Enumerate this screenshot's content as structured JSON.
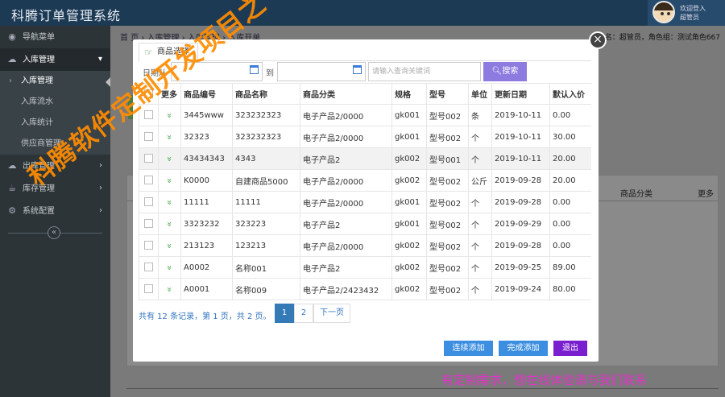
{
  "app": {
    "title": "科腾订单管理系统"
  },
  "user": {
    "greeting": "欢迎登入",
    "name": "超管员"
  },
  "sidebar": {
    "items": [
      {
        "label": "导航菜单",
        "icon": "dashboard-icon"
      },
      {
        "label": "入库管理",
        "icon": "cloud-upload-icon"
      },
      {
        "label": "出库管理",
        "icon": "cloud-download-icon"
      },
      {
        "label": "库存管理",
        "icon": "cup-icon"
      },
      {
        "label": "系统配置",
        "icon": "gear-icon"
      }
    ],
    "sub_items": [
      {
        "label": "入库管理"
      },
      {
        "label": "入库流水"
      },
      {
        "label": "入库统计"
      },
      {
        "label": "供应商管理"
      }
    ],
    "collapse_glyph": "«"
  },
  "breadcrumb": {
    "text": "首 页 › 入库管理 › 入库管理 › 入库开单"
  },
  "user_role": "名：超管员，角色组：测试角色667",
  "background_table": {
    "headers": [
      "商品分类",
      "更多"
    ]
  },
  "modal": {
    "tab_label": "商品选择",
    "date_from_label": "日期从",
    "date_to_label": "到",
    "search_placeholder": "请输入查询关键词",
    "search_button": "搜索",
    "close_glyph": "×",
    "table": {
      "headers": [
        "更多",
        "商品编号",
        "商品名称",
        "商品分类",
        "规格",
        "型号",
        "单位",
        "更新日期",
        "默认入价"
      ],
      "rows": [
        [
          "3445www",
          "323232323",
          "电子产品2/0000",
          "gk001",
          "型号002",
          "条",
          "2019-10-11",
          "0.00"
        ],
        [
          "32323",
          "323232323",
          "电子产品2/0000",
          "gk001",
          "型号002",
          "个",
          "2019-10-11",
          "30.00"
        ],
        [
          "43434343",
          "4343",
          "电子产品2",
          "gk002",
          "型号001",
          "个",
          "2019-10-11",
          "20.00"
        ],
        [
          "K0000",
          "自建商品5000",
          "电子产品2/0000",
          "gk002",
          "型号002",
          "公斤",
          "2019-09-28",
          "20.00"
        ],
        [
          "11111",
          "11111",
          "电子产品2/0000",
          "gk001",
          "型号002",
          "个",
          "2019-09-28",
          "0.00"
        ],
        [
          "3323232",
          "323223",
          "电子产品2",
          "gk001",
          "型号002",
          "个",
          "2019-09-29",
          "0.00"
        ],
        [
          "213123",
          "123213",
          "电子产品2/0000",
          "gk002",
          "型号002",
          "个",
          "2019-09-28",
          "0.00"
        ],
        [
          "A0002",
          "名称001",
          "电子产品2",
          "gk002",
          "型号002",
          "个",
          "2019-09-25",
          "89.00"
        ],
        [
          "A0001",
          "名称009",
          "电子产品2/2423432",
          "gk002",
          "型号002",
          "个",
          "2019-09-24",
          "80.00"
        ]
      ]
    },
    "pager": {
      "summary": "共有 12 条记录，第 1 页，共 2 页。",
      "page1": "1",
      "page2": "2",
      "next": "下一页"
    },
    "buttons": {
      "continue_add": "连续添加",
      "finish_add": "完成添加",
      "exit": "退出"
    },
    "colors": {
      "continue": "#3b8ee0",
      "finish": "#3b8ee0",
      "exit": "#7a1fd0",
      "search": "#8d7be0"
    }
  },
  "watermarks": {
    "main": "科腾软件定制开发项目之一",
    "footer": "有定制需求，想在线体验请与我们联系"
  }
}
